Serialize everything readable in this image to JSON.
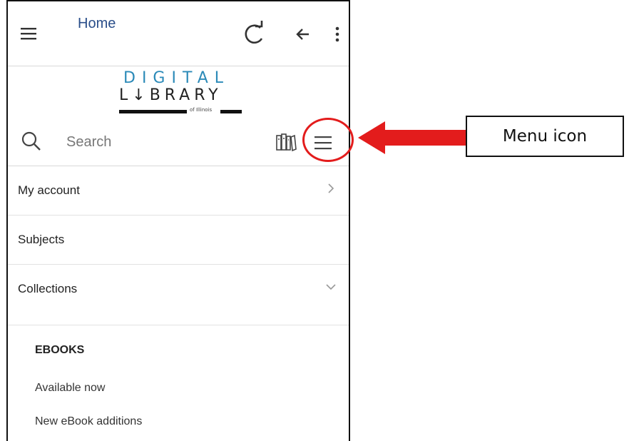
{
  "topbar": {
    "title": "Home",
    "icons": [
      "hamburger-icon",
      "refresh-icon",
      "back-arrow-icon",
      "more-vertical-icon"
    ]
  },
  "logo": {
    "line1": "DIGITAL",
    "line2": "LIBRARY",
    "line2_display": "L↓BRARY",
    "tagline": "of Illinois",
    "brand_color": "#2b8ab8"
  },
  "search": {
    "placeholder": "Search",
    "icons": [
      "search-icon",
      "bookshelf-icon",
      "menu-icon"
    ]
  },
  "menu": {
    "items": [
      {
        "label": "My account",
        "chevron": "right"
      },
      {
        "label": "Subjects"
      },
      {
        "label": "Collections",
        "chevron": "down"
      }
    ],
    "submenu": {
      "heading": "EBOOKS",
      "items": [
        "Available now",
        "New eBook additions"
      ]
    }
  },
  "annotation": {
    "label": "Menu icon",
    "color": "#e31c1c"
  }
}
